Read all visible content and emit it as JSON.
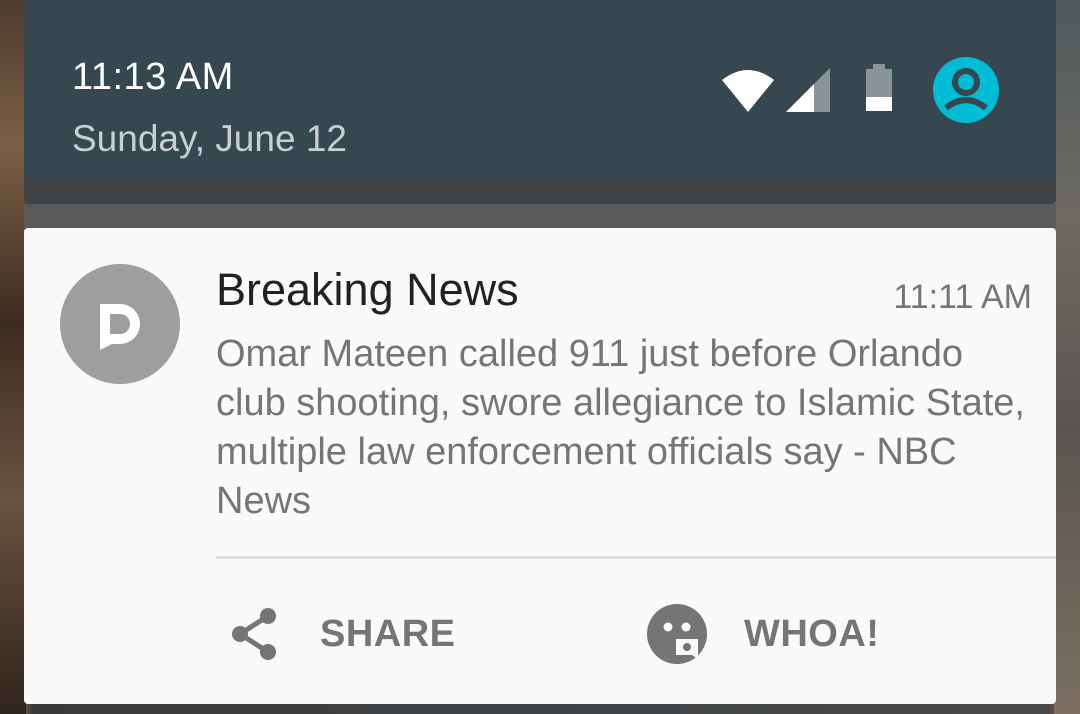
{
  "status_bar": {
    "time": "11:13 AM",
    "date": "Sunday, June 12",
    "icons": [
      "wifi-icon",
      "cell-signal-icon",
      "battery-icon",
      "account-icon"
    ],
    "account_color": "#00bcd4"
  },
  "notification": {
    "app_icon": "app-logo-icon",
    "title": "Breaking News",
    "time": "11:11 AM",
    "body": "Omar Mateen called 911 just before Orlando club shooting, swore allegiance to Islamic State, multiple law enforcement officials say - NBC News",
    "actions": [
      {
        "label": "SHARE",
        "icon": "share-icon"
      },
      {
        "label": "WHOA!",
        "icon": "whoa-face-icon"
      }
    ]
  }
}
